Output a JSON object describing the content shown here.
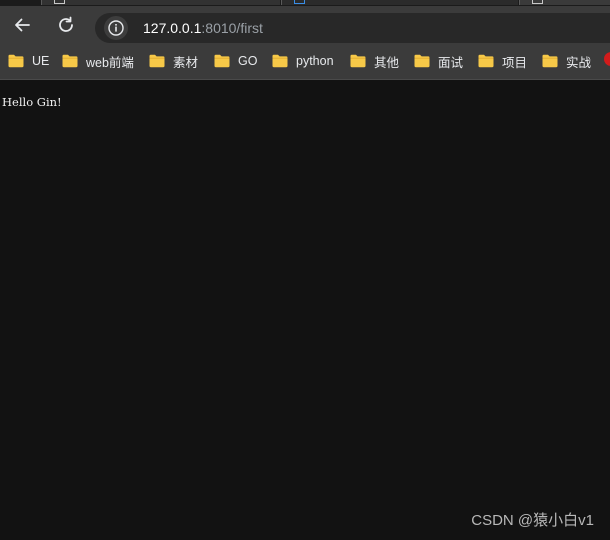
{
  "browser": {
    "address_bar": {
      "url_host": "127.0.0.1",
      "url_path": ":8010/first"
    },
    "icons": {
      "back": "back-arrow-icon",
      "reload": "reload-icon",
      "site_info": "info-icon",
      "folder": "folder-icon"
    },
    "bookmarks": [
      {
        "label": "UE"
      },
      {
        "label": "web前端"
      },
      {
        "label": "素材"
      },
      {
        "label": "GO"
      },
      {
        "label": "python"
      },
      {
        "label": "其他"
      },
      {
        "label": "面试"
      },
      {
        "label": "项目"
      },
      {
        "label": "实战"
      }
    ]
  },
  "page": {
    "body_text": "Hello Gin!"
  },
  "watermark": {
    "text": "CSDN @猿小白v1"
  },
  "colors": {
    "page_background": "#121212",
    "toolbar_background": "#3b3b3b",
    "omnibox_background": "#282828",
    "folder_yellow": "#f7c948"
  }
}
